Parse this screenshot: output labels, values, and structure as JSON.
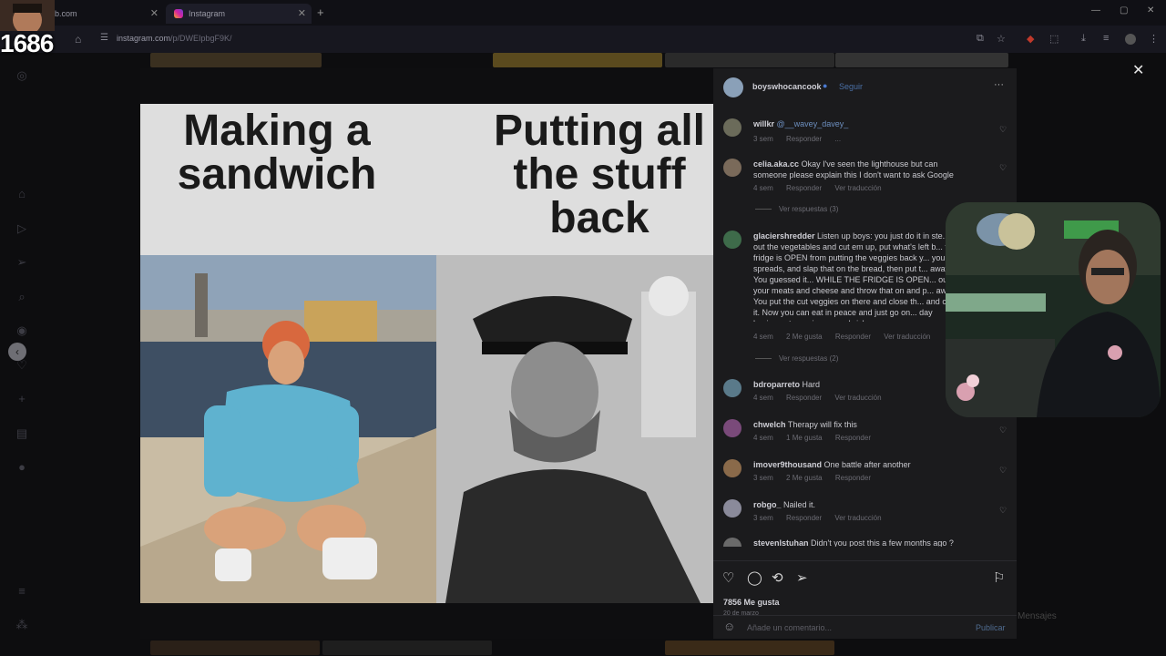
{
  "browser": {
    "tabs": [
      {
        "title": "b.com",
        "active": false
      },
      {
        "title": "Instagram",
        "active": true
      }
    ],
    "url_host": "instagram.com",
    "url_path": "/p/DWEIpbgF9K/"
  },
  "stream": {
    "viewer_count": "1686"
  },
  "post": {
    "author": "boyswhocancook",
    "follow_label": "Seguir",
    "meme_left_caption": "Making a sandwich",
    "meme_right_caption": "Putting all the stuff back",
    "likes": "7856 Me gusta",
    "date": "20 de marzo",
    "comment_placeholder": "Añade un comentario...",
    "publish_label": "Publicar"
  },
  "comments": [
    {
      "user": "willkr",
      "text": "@__wavey_davey_",
      "time": "3 sem",
      "actions": [
        "Responder",
        "..."
      ]
    },
    {
      "user": "celia.aka.cc",
      "text": "Okay I've seen the lighthouse but can someone please explain this I don't want to ask Google",
      "time": "4 sem",
      "actions": [
        "Responder",
        "Ver traducción"
      ],
      "replies": "Ver respuestas (3)"
    },
    {
      "user": "glaciershredder",
      "text": "Listen up boys: you just do it in ste... out the vegetables and cut em up, put what's left b... the fridge is OPEN from putting the veggies back y... your spreads, and slap that on the bread, then put t... away... You guessed it... WHILE THE FRIDGE IS OPEN... out your meats and cheese and throw that on and p... away. You put the cut veggies on there and close th... and cut it. Now you can eat in peace and just go on... day having eaten a ripper sandwich.",
      "time": "4 sem",
      "likes": "2 Me gusta",
      "actions": [
        "Responder",
        "Ver traducción"
      ],
      "replies": "Ver respuestas (2)"
    },
    {
      "user": "bdroparreto",
      "text": "Hard",
      "time": "4 sem",
      "actions": [
        "Responder",
        "Ver traducción"
      ]
    },
    {
      "user": "chwelch",
      "text": "Therapy will fix this",
      "time": "4 sem",
      "likes": "1 Me gusta",
      "actions": [
        "Responder"
      ]
    },
    {
      "user": "imover9thousand",
      "text": "One battle after another",
      "time": "3 sem",
      "likes": "2 Me gusta",
      "actions": [
        "Responder"
      ]
    },
    {
      "user": "robgo_",
      "text": "Nailed it.",
      "time": "3 sem",
      "actions": [
        "Responder",
        "Ver traducción"
      ]
    },
    {
      "user": "stevenlstuhan",
      "text": "Didn't you post this a few months ago ?",
      "time": "",
      "actions": []
    }
  ],
  "background": {
    "messages_label": "Mensajes"
  },
  "colors": {
    "accent_blue": "#4a6fa5",
    "panel_bg": "#1b1b1d",
    "page_bg": "#0d0d0f"
  }
}
